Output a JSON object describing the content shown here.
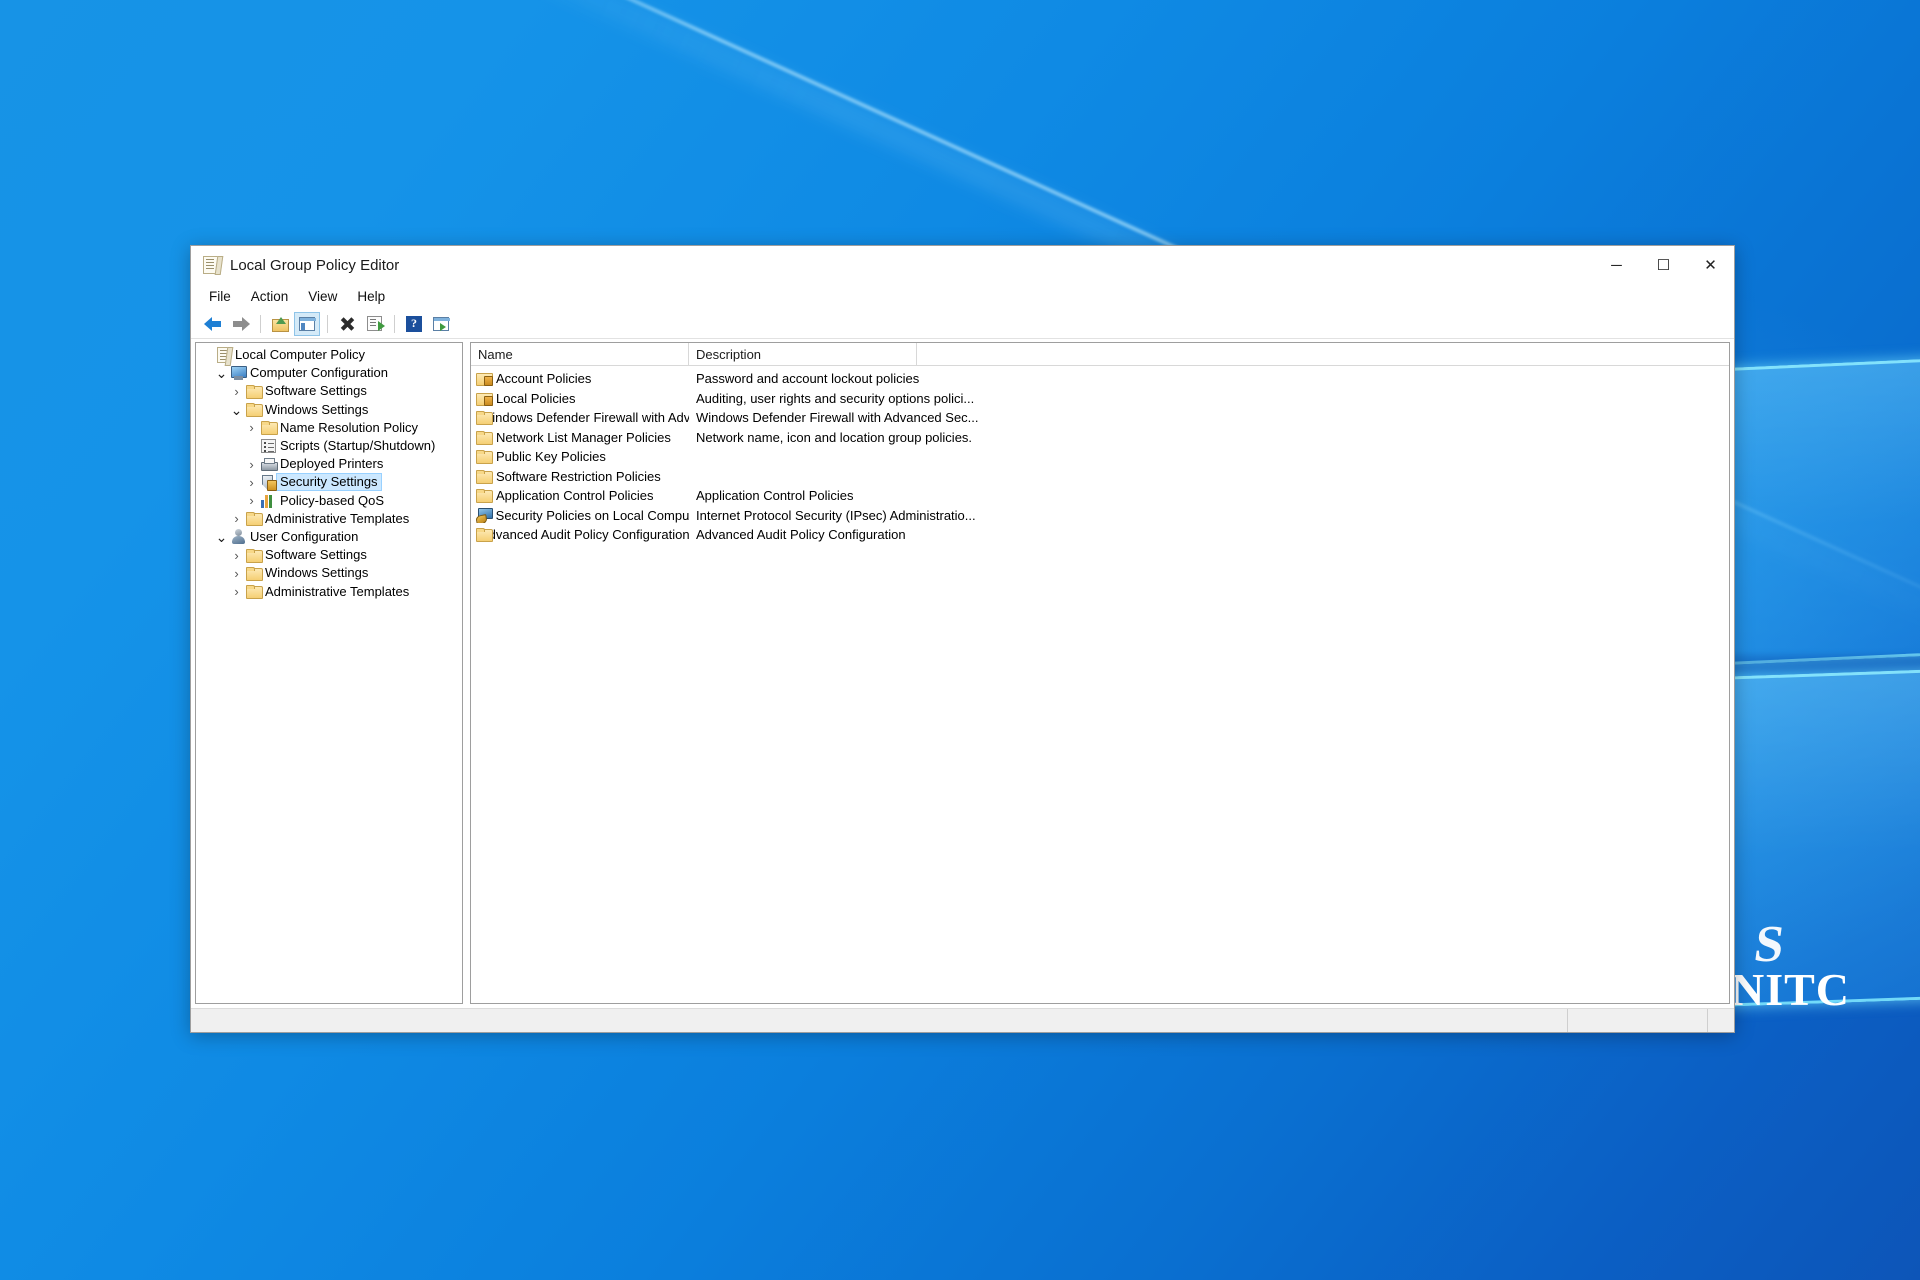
{
  "desktop": {
    "watermark_logo": "S",
    "watermark_text": "SINITC"
  },
  "window": {
    "title": "Local Group Policy Editor",
    "title_icon": "policy-document-icon",
    "controls": {
      "minimize": "─",
      "maximize": "☐",
      "close": "✕"
    }
  },
  "menubar": {
    "items": [
      {
        "label": "File"
      },
      {
        "label": "Action"
      },
      {
        "label": "View"
      },
      {
        "label": "Help"
      }
    ]
  },
  "toolbar": {
    "buttons": [
      {
        "name": "back-button",
        "icon": "back-arrow-icon",
        "pressed": false
      },
      {
        "name": "forward-button",
        "icon": "forward-arrow-icon",
        "pressed": false
      },
      {
        "name": "up-one-level-button",
        "icon": "up-folder-icon",
        "pressed": false
      },
      {
        "name": "show-hide-tree-button",
        "icon": "tree-view-icon",
        "pressed": true
      },
      {
        "name": "delete-button",
        "icon": "delete-x-icon",
        "pressed": false
      },
      {
        "name": "export-list-button",
        "icon": "export-list-icon",
        "pressed": false
      },
      {
        "name": "help-button",
        "icon": "question-mark-icon",
        "pressed": false
      },
      {
        "name": "view-options-button",
        "icon": "filter-view-icon",
        "pressed": false
      }
    ]
  },
  "tree": {
    "nodes": [
      {
        "label": "Local Computer Policy",
        "indent": 0,
        "icon": "policy-document-icon",
        "twist": "none",
        "selected": false
      },
      {
        "label": "Computer Configuration",
        "indent": 1,
        "icon": "monitor-icon",
        "twist": "expanded",
        "selected": false
      },
      {
        "label": "Software Settings",
        "indent": 2,
        "icon": "folder-icon",
        "twist": "collapsed",
        "selected": false
      },
      {
        "label": "Windows Settings",
        "indent": 2,
        "icon": "folder-icon",
        "twist": "expanded",
        "selected": false
      },
      {
        "label": "Name Resolution Policy",
        "indent": 3,
        "icon": "folder-icon",
        "twist": "collapsed",
        "selected": false
      },
      {
        "label": "Scripts (Startup/Shutdown)",
        "indent": 3,
        "icon": "script-icon",
        "twist": "none",
        "selected": false
      },
      {
        "label": "Deployed Printers",
        "indent": 3,
        "icon": "printer-icon",
        "twist": "collapsed",
        "selected": false
      },
      {
        "label": "Security Settings",
        "indent": 3,
        "icon": "shield-lock-icon",
        "twist": "collapsed",
        "selected": true
      },
      {
        "label": "Policy-based QoS",
        "indent": 3,
        "icon": "bar-chart-icon",
        "twist": "collapsed",
        "selected": false
      },
      {
        "label": "Administrative Templates",
        "indent": 2,
        "icon": "folder-icon",
        "twist": "collapsed",
        "selected": false
      },
      {
        "label": "User Configuration",
        "indent": 1,
        "icon": "user-icon",
        "twist": "expanded",
        "selected": false
      },
      {
        "label": "Software Settings",
        "indent": 2,
        "icon": "folder-icon",
        "twist": "collapsed",
        "selected": false
      },
      {
        "label": "Windows Settings",
        "indent": 2,
        "icon": "folder-icon",
        "twist": "collapsed",
        "selected": false
      },
      {
        "label": "Administrative Templates",
        "indent": 2,
        "icon": "folder-icon",
        "twist": "collapsed",
        "selected": false
      }
    ]
  },
  "list": {
    "columns": [
      {
        "label": "Name"
      },
      {
        "label": "Description"
      },
      {
        "label": ""
      }
    ],
    "rows": [
      {
        "name": "Account Policies",
        "icon": "folder-lock-icon",
        "description": "Password and account lockout policies"
      },
      {
        "name": "Local Policies",
        "icon": "folder-lock-icon",
        "description": "Auditing, user rights and security options polici..."
      },
      {
        "name": "Windows Defender Firewall with Advanc...",
        "icon": "folder-icon",
        "description": "Windows Defender Firewall with Advanced Sec..."
      },
      {
        "name": "Network List Manager Policies",
        "icon": "folder-icon",
        "description": "Network name, icon and location group policies."
      },
      {
        "name": "Public Key Policies",
        "icon": "folder-icon",
        "description": ""
      },
      {
        "name": "Software Restriction Policies",
        "icon": "folder-icon",
        "description": ""
      },
      {
        "name": "Application Control Policies",
        "icon": "folder-icon",
        "description": "Application Control Policies"
      },
      {
        "name": "IP Security Policies on Local Computer",
        "icon": "ipsec-computer-icon",
        "description": "Internet Protocol Security (IPsec) Administratio..."
      },
      {
        "name": "Advanced Audit Policy Configuration",
        "icon": "folder-icon",
        "description": "Advanced Audit Policy Configuration"
      }
    ]
  },
  "statusbar": {
    "message": ""
  },
  "colors": {
    "accent": "#0078d7",
    "selection": "#cce8ff",
    "window_bg": "#ffffff",
    "status_bg": "#f0f0f0"
  }
}
